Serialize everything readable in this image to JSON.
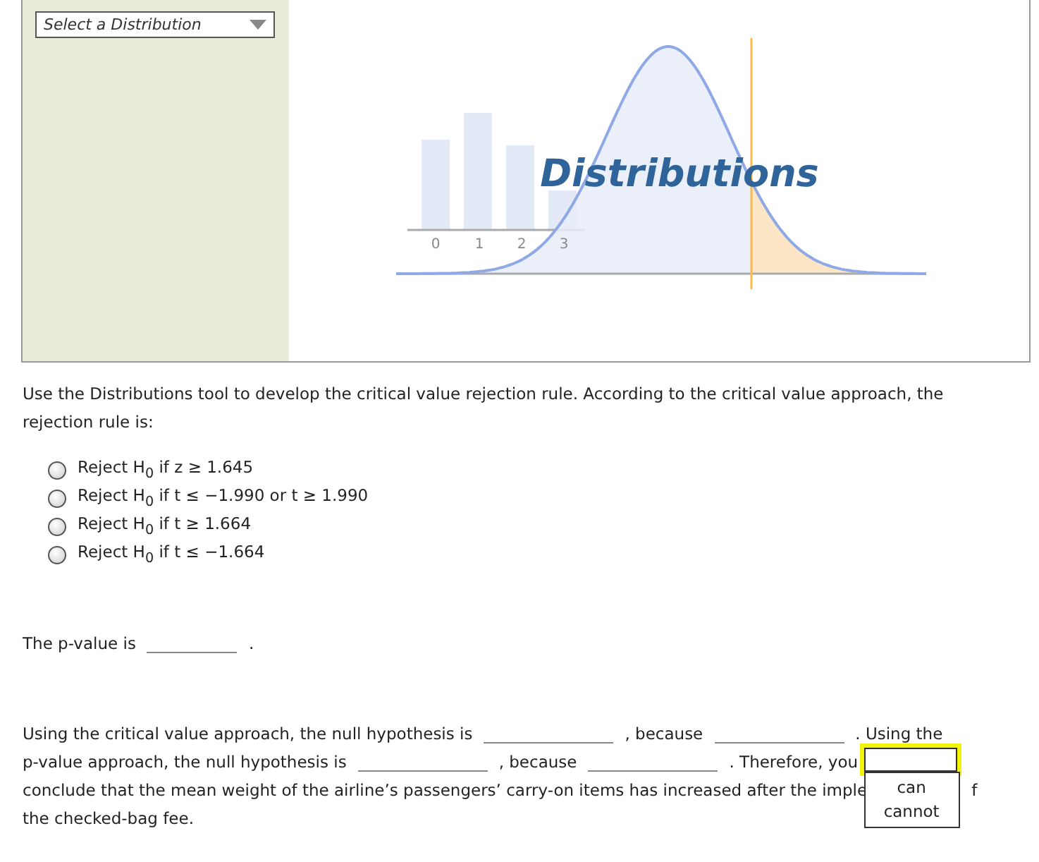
{
  "distribution_tool": {
    "select": {
      "placeholder": "Select a Distribution"
    },
    "title": "Distributions",
    "axis_labels": [
      "0",
      "1",
      "2",
      "3"
    ]
  },
  "instructions": "Use the Distributions tool to develop the critical value rejection rule. According to the critical value approach, the rejection rule is:",
  "options": [
    {
      "label": "Reject H$_{0}$ if z ≥ 1.645",
      "selected": false
    },
    {
      "label": "Reject H$_{0}$ if t ≤ −1.990 or t ≥ 1.990",
      "selected": false
    },
    {
      "label": "Reject H$_{0}$ if t ≥ 1.664",
      "selected": false
    },
    {
      "label": "Reject H$_{0}$ if t ≤ −1.664",
      "selected": false
    }
  ],
  "p_value": {
    "label": "The p-value is",
    "end": "."
  },
  "conclusion_lines": [
    [
      {
        "kind": "text",
        "text": "Using the critical value approach, the null hypothesis is"
      },
      {
        "kind": "blank"
      },
      {
        "kind": "text",
        "text": ", because"
      },
      {
        "kind": "blank"
      },
      {
        "kind": "text",
        "text": ". Using the"
      }
    ],
    [
      {
        "kind": "text",
        "text": "p-value approach, the null hypothesis is"
      },
      {
        "kind": "blank"
      },
      {
        "kind": "text",
        "text": ", because"
      },
      {
        "kind": "blank"
      },
      {
        "kind": "text",
        "text": ". Therefore, you"
      },
      {
        "kind": "dropdown",
        "expanded": true,
        "focused": true,
        "options": [
          "can",
          "cannot"
        ]
      }
    ],
    [
      {
        "kind": "text",
        "text": "conclude that the mean weight of the airline’s passengers’ carry-on items has increased after the imple"
      },
      {
        "kind": "gap"
      },
      {
        "kind": "text",
        "text": "f"
      }
    ],
    [
      {
        "kind": "text",
        "text": "the checked-bag fee."
      }
    ]
  ]
}
